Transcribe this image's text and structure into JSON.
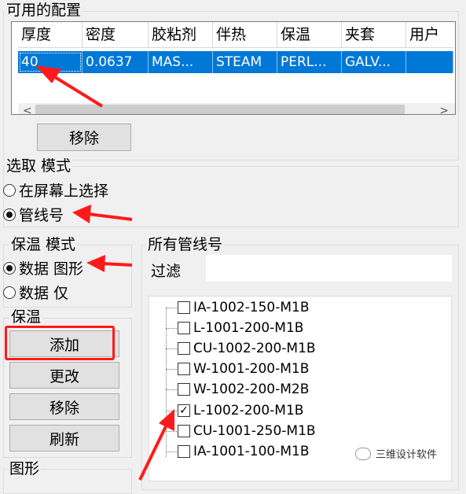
{
  "available_config": {
    "title": "可用的配置",
    "columns": [
      "厚度",
      "密度",
      "胶粘剂",
      "伴热",
      "保温",
      "夹套",
      "用户"
    ],
    "row": [
      "40",
      "0.0637",
      "MAS...",
      "STEAM",
      "PERL...",
      "GALV...",
      ""
    ],
    "scroll_left": "<",
    "scroll_right": ">",
    "remove_label": "移除"
  },
  "select_mode": {
    "title": "选取 模式",
    "options": [
      "在屏幕上选择",
      "管线号"
    ],
    "selected": 1
  },
  "insulation_mode": {
    "title": "保温 模式",
    "options": [
      "数据 图形",
      "数据 仅"
    ],
    "selected": 0
  },
  "insulation": {
    "title": "保温",
    "add_label": "添加",
    "modify_label": "更改",
    "remove_label": "移除",
    "refresh_label": "刷新"
  },
  "graphics": {
    "title": "图形"
  },
  "all_lines": {
    "title": "所有管线号",
    "filter_label": "过滤",
    "filter_value": "",
    "items": [
      {
        "label": "IA-1002-150-M1B",
        "checked": false
      },
      {
        "label": "L-1001-200-M1B",
        "checked": false
      },
      {
        "label": "CU-1002-200-M1B",
        "checked": false
      },
      {
        "label": "W-1001-200-M1B",
        "checked": false
      },
      {
        "label": "W-1002-200-M2B",
        "checked": false
      },
      {
        "label": "L-1002-200-M1B",
        "checked": true
      },
      {
        "label": "CU-1001-250-M1B",
        "checked": false
      },
      {
        "label": "IA-1001-100-M1B",
        "checked": false
      }
    ]
  },
  "watermark": "三维设计软件",
  "colors": {
    "annotation": "#ff1a1a",
    "selection": "#0078d7"
  }
}
